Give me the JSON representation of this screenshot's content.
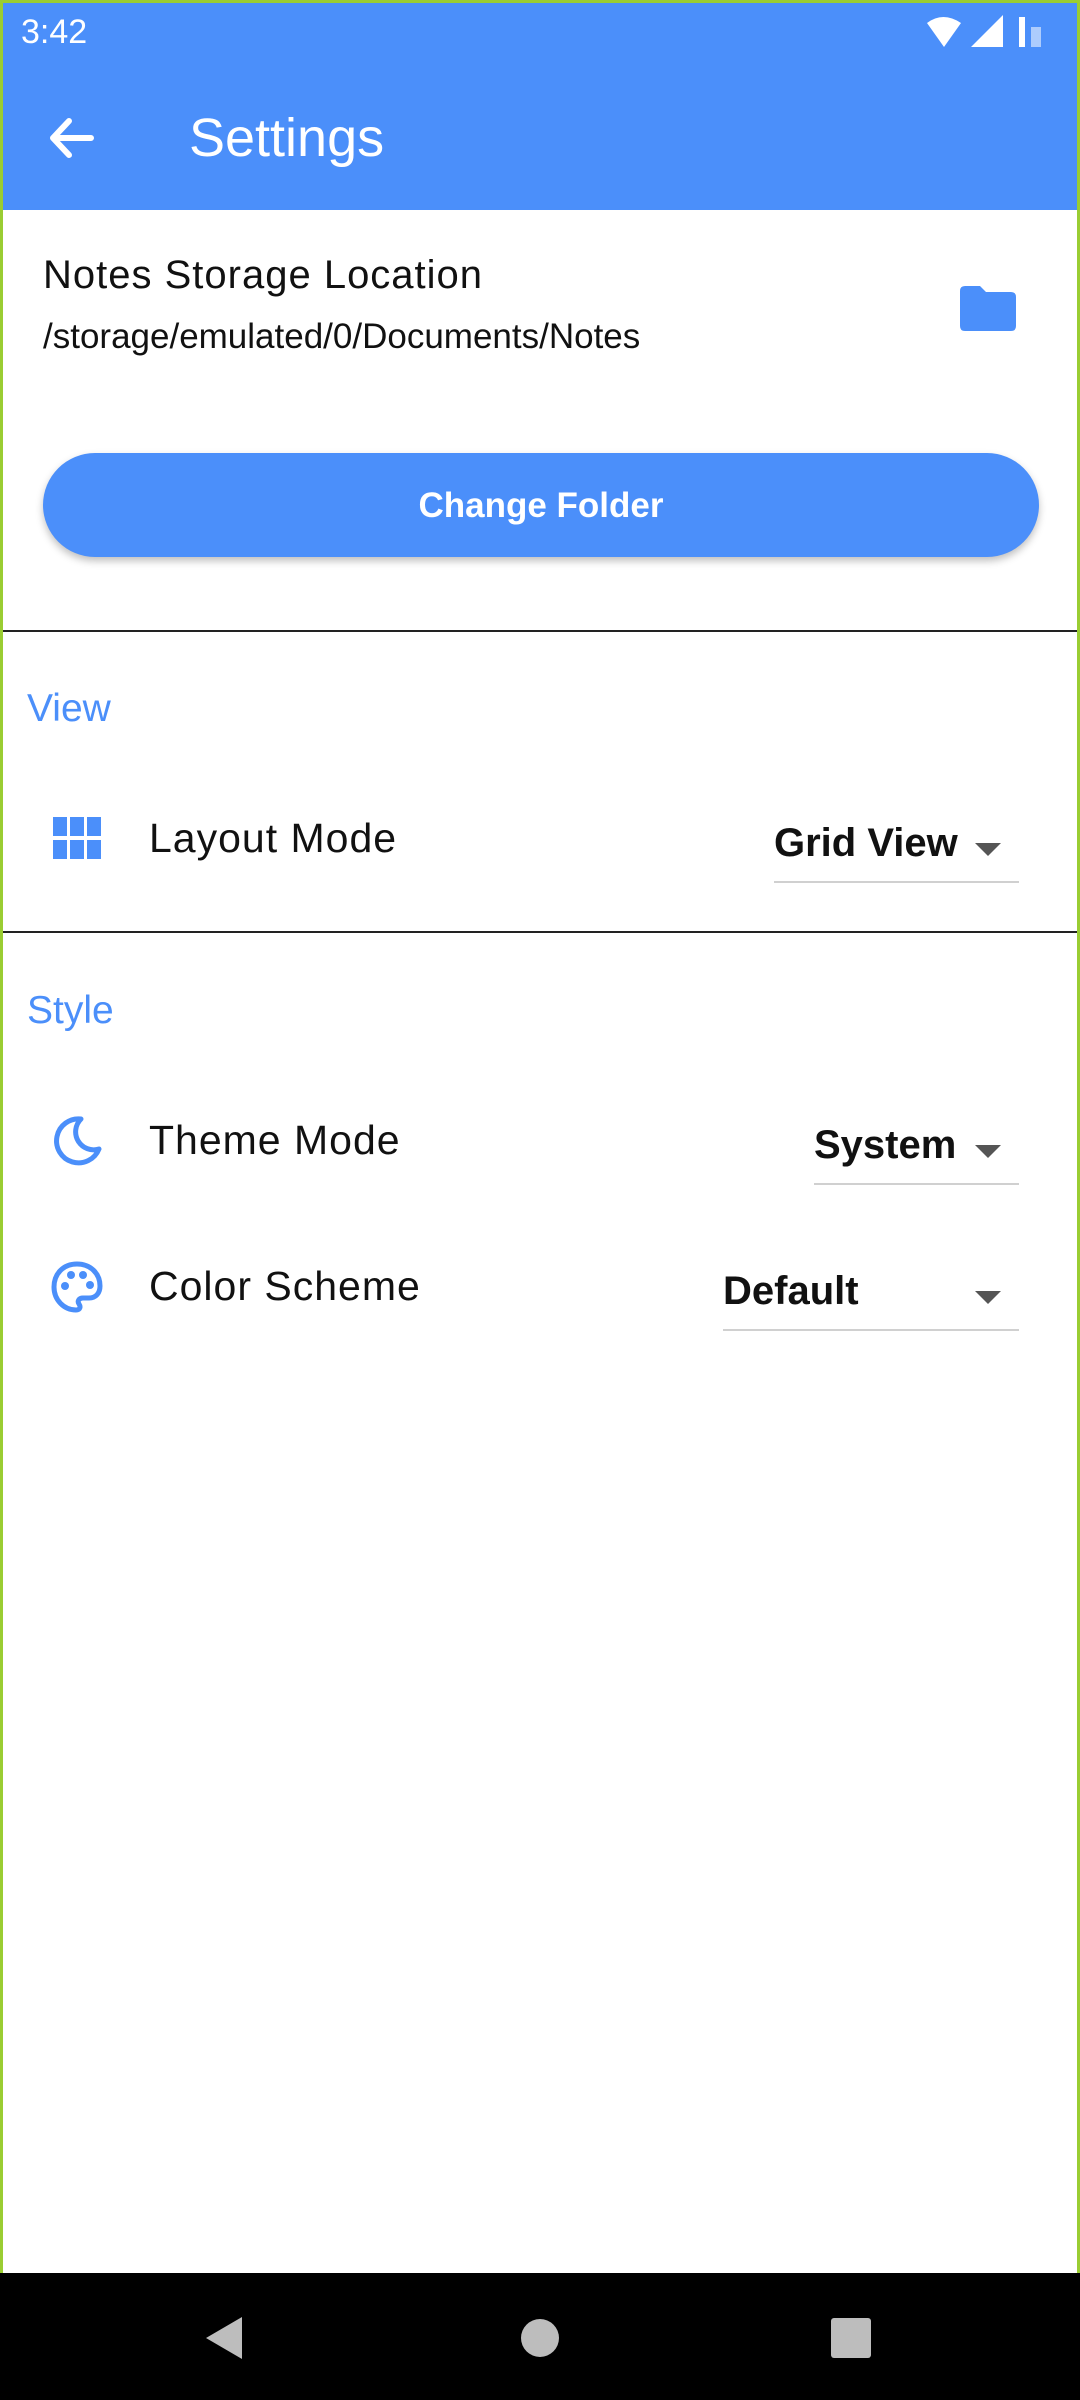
{
  "status_bar": {
    "time": "3:42",
    "icons": [
      "wifi-icon",
      "signal-icon",
      "battery-icon"
    ]
  },
  "app_bar": {
    "title": "Settings",
    "back_icon": "arrow-back-icon",
    "color": "#4b8ffa"
  },
  "storage": {
    "label": "Notes Storage Location",
    "path": "/storage/emulated/0/Documents/Notes",
    "icon": "folder-icon",
    "change_button": "Change Folder"
  },
  "sections": {
    "view": {
      "header": "View",
      "layout_mode": {
        "label": "Layout Mode",
        "icon": "grid-icon",
        "value": "Grid View"
      }
    },
    "style": {
      "header": "Style",
      "theme_mode": {
        "label": "Theme Mode",
        "icon": "moon-icon",
        "value": "System"
      },
      "color_scheme": {
        "label": "Color Scheme",
        "icon": "palette-icon",
        "value": "Default"
      }
    }
  },
  "nav_bar": {
    "icons": [
      "back-triangle-icon",
      "home-circle-icon",
      "recents-square-icon"
    ]
  }
}
